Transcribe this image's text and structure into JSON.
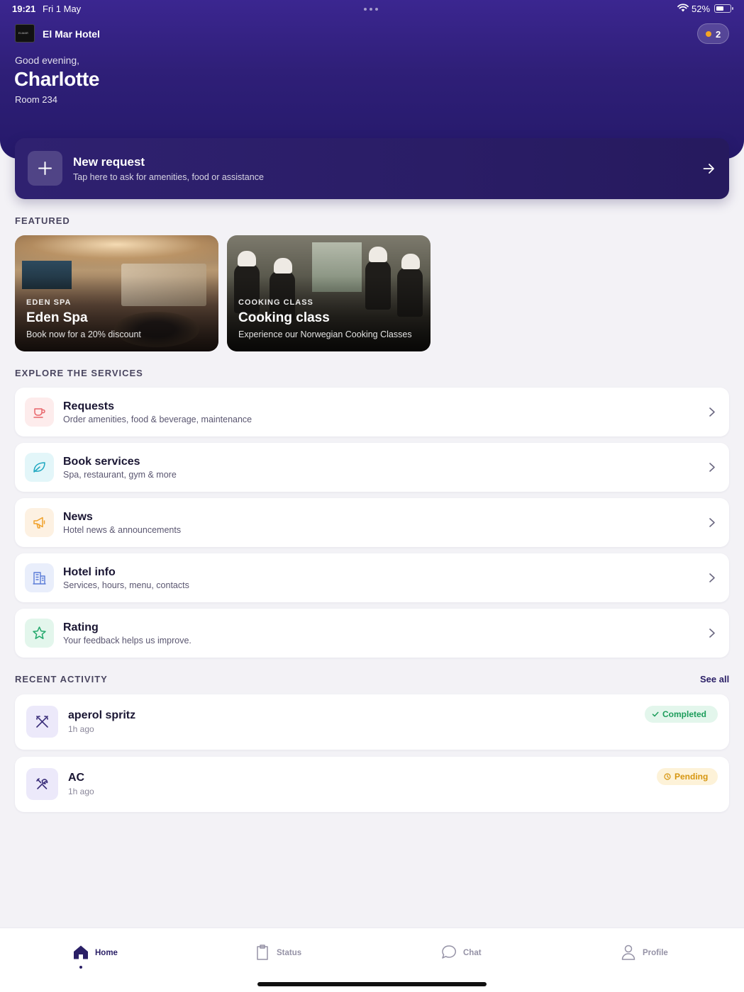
{
  "status_bar": {
    "time": "19:21",
    "date": "Fri 1 May",
    "battery": "52%"
  },
  "header": {
    "hotel_name": "El Mar Hotel",
    "logo_text": "ELMAR",
    "notification_count": "2",
    "greeting": "Good evening,",
    "guest_name": "Charlotte",
    "room": "Room 234"
  },
  "new_request": {
    "title": "New request",
    "subtitle": "Tap here to ask for amenities, food or assistance"
  },
  "featured": {
    "label": "FEATURED",
    "cards": [
      {
        "kicker": "EDEN SPA",
        "title": "Eden Spa",
        "subtitle": "Book now for a 20% discount"
      },
      {
        "kicker": "COOKING CLASS",
        "title": "Cooking class",
        "subtitle": "Experience our Norwegian Cooking Classes"
      }
    ]
  },
  "services": {
    "label": "EXPLORE THE SERVICES",
    "items": [
      {
        "title": "Requests",
        "subtitle": "Order amenities, food & beverage, maintenance",
        "icon": "cup-icon",
        "color": "#e8656a"
      },
      {
        "title": "Book services",
        "subtitle": "Spa, restaurant, gym & more",
        "icon": "leaf-icon",
        "color": "#1ea7c0"
      },
      {
        "title": "News",
        "subtitle": "Hotel news & announcements",
        "icon": "megaphone-icon",
        "color": "#f0a12b"
      },
      {
        "title": "Hotel info",
        "subtitle": "Services, hours, menu, contacts",
        "icon": "building-icon",
        "color": "#5a7bd8"
      },
      {
        "title": "Rating",
        "subtitle": "Your feedback helps us improve.",
        "icon": "star-icon",
        "color": "#22a86b"
      }
    ]
  },
  "recent_activity": {
    "label": "RECENT ACTIVITY",
    "see_all": "See all",
    "items": [
      {
        "title": "aperol spritz",
        "time": "1h ago",
        "status": "Completed",
        "icon": "cutlery-icon"
      },
      {
        "title": "AC",
        "time": "1h ago",
        "status": "Pending",
        "icon": "tools-icon"
      }
    ]
  },
  "tabs": [
    {
      "label": "Home",
      "icon": "home-icon",
      "active": true
    },
    {
      "label": "Status",
      "icon": "clipboard-icon",
      "active": false
    },
    {
      "label": "Chat",
      "icon": "chat-icon",
      "active": false
    },
    {
      "label": "Profile",
      "icon": "user-icon",
      "active": false
    }
  ],
  "colors": {
    "brand": "#2f1f78",
    "completed": "#1c9d5b",
    "pending": "#d6950f",
    "notification_dot": "#f5a623"
  }
}
